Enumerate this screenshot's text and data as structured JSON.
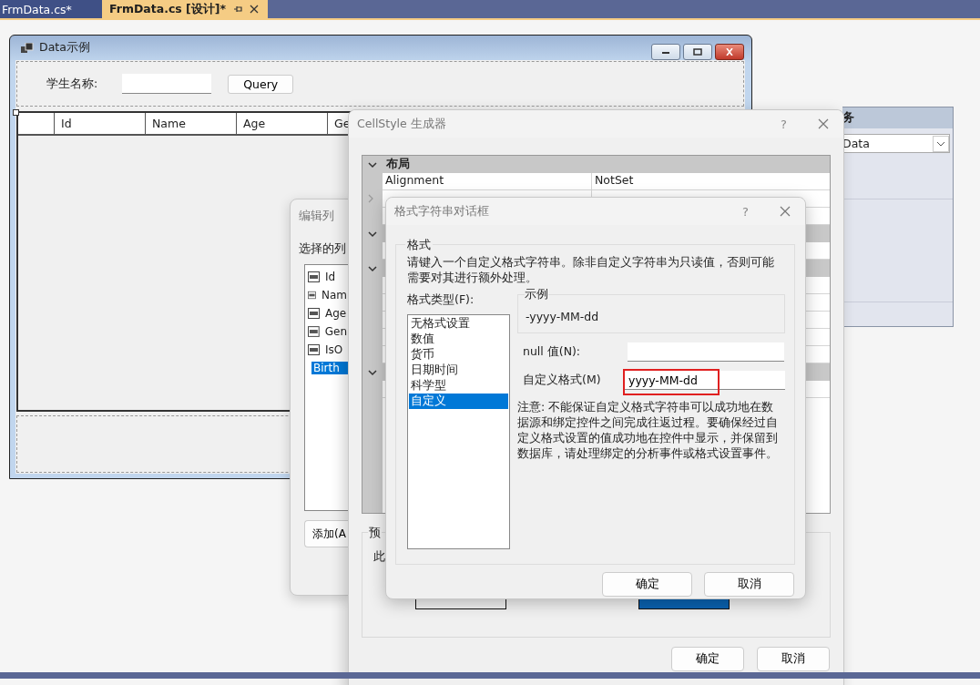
{
  "editor_tabs": [
    {
      "label": "FrmData.cs*",
      "selected": false
    },
    {
      "label": "FrmData.cs [设计]*",
      "selected": true
    }
  ],
  "form": {
    "title": "Data示例",
    "search_label": "学生名称:",
    "query_button": "Query",
    "grid_columns": [
      "Id",
      "Name",
      "Age",
      "Ge"
    ]
  },
  "tasks_panel": {
    "title": "务",
    "data_source": "Data"
  },
  "edit_columns_dialog": {
    "title": "编辑列",
    "list_label": "选择的列",
    "columns": [
      {
        "name": "Id",
        "selected": false
      },
      {
        "name": "Nam",
        "selected": false
      },
      {
        "name": "Age",
        "selected": false
      },
      {
        "name": "Gen",
        "selected": false
      },
      {
        "name": "IsO",
        "selected": false
      },
      {
        "name": "Birth",
        "selected": true
      }
    ],
    "add_button": "添加(A"
  },
  "cellstyle_dialog": {
    "title": "CellStyle 生成器",
    "help": "?",
    "categories": [
      {
        "name": "布局",
        "expanded": true,
        "rows": [
          {
            "name": "Alignment",
            "value": "NotSet"
          }
        ]
      }
    ],
    "preview_label": "预",
    "preview_text": "此",
    "buttons": [
      "确定",
      "取消"
    ]
  },
  "format_dialog": {
    "title": "格式字符串对话框",
    "help": "?",
    "group_label": "格式",
    "description": "请键入一个自定义格式字符串。除非自定义字符串为只读值，否则可能需要对其进行额外处理。",
    "type_label": "格式类型(F):",
    "format_types": [
      {
        "label": "无格式设置",
        "selected": false
      },
      {
        "label": "数值",
        "selected": false
      },
      {
        "label": "货币",
        "selected": false
      },
      {
        "label": "日期时间",
        "selected": false
      },
      {
        "label": "科学型",
        "selected": false
      },
      {
        "label": "自定义",
        "selected": true
      }
    ],
    "sample_label": "示例",
    "sample": "-yyyy-MM-dd",
    "null_label": "null 值(N):",
    "custom_label": "自定义格式(M)",
    "custom_value": "yyyy-MM-dd",
    "custom_highlighted": true,
    "note": "注意: 不能保证自定义格式字符串可以成功地在数据源和绑定控件之间完成往返过程。要确保经过自定义格式设置的值成功地在控件中显示，并保留到数据库，请处理绑定的分析事件或格式设置事件。",
    "buttons": [
      "确定",
      "取消"
    ]
  }
}
